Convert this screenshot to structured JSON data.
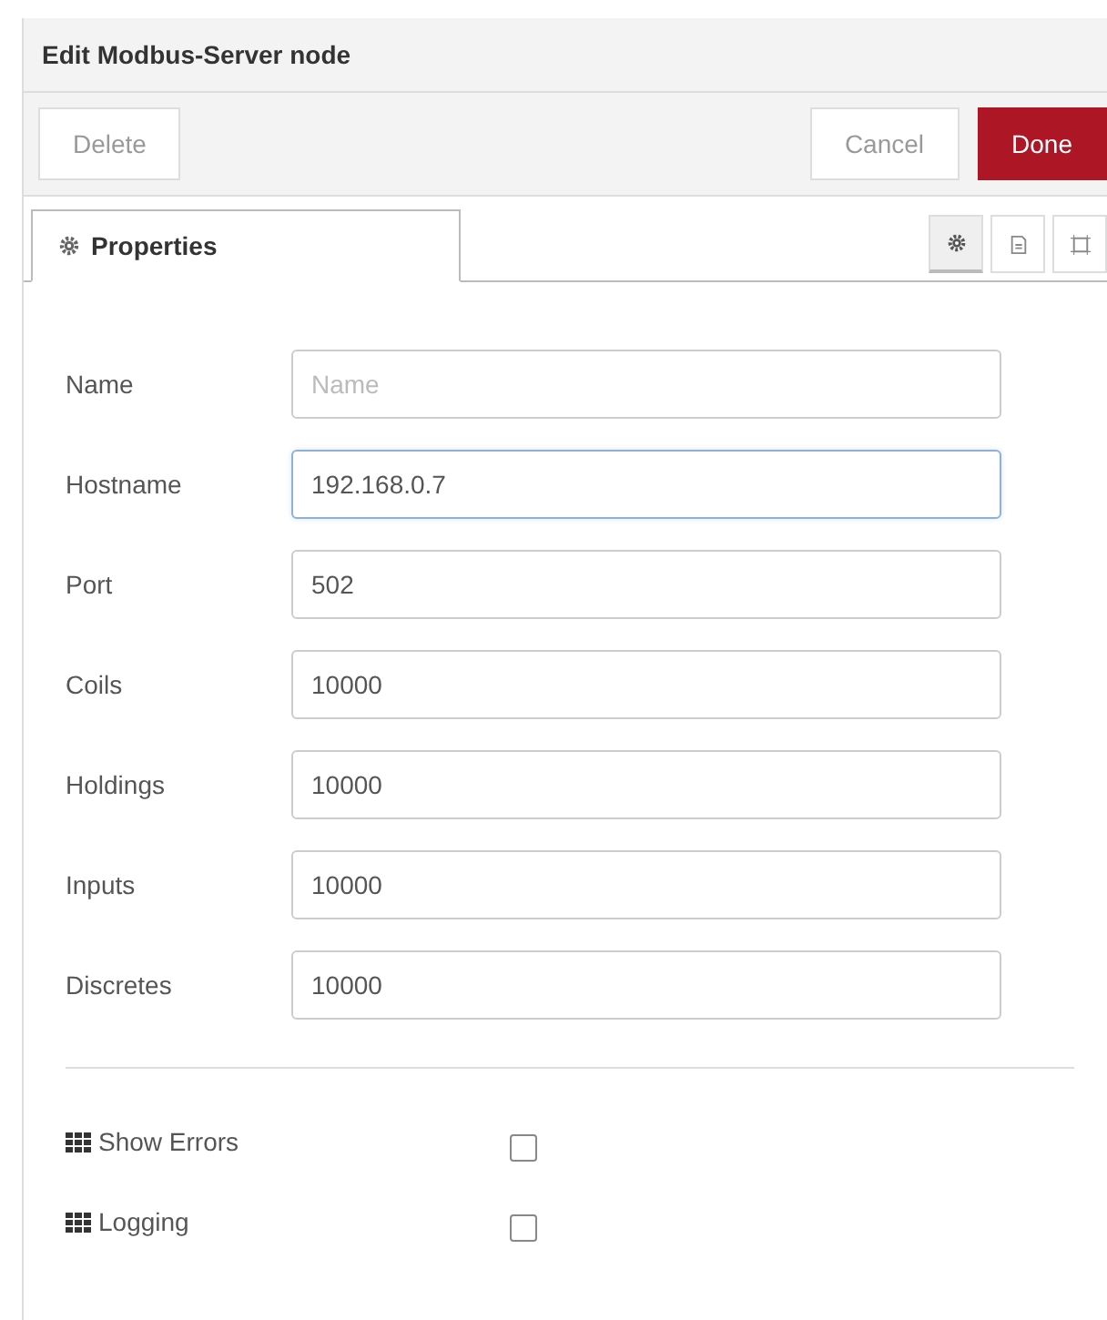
{
  "window": {
    "title": "Edit Modbus-Server node"
  },
  "buttons": {
    "delete": "Delete",
    "cancel": "Cancel",
    "done": "Done"
  },
  "tabs": [
    {
      "label": "Properties",
      "selected": true
    }
  ],
  "tab_icons": [
    {
      "kind": "gear",
      "selected": true
    },
    {
      "kind": "document",
      "selected": false
    },
    {
      "kind": "frame",
      "selected": false
    }
  ],
  "fields": [
    {
      "label": "Name",
      "placeholder": "Name",
      "focused": false
    },
    {
      "label": "Hostname",
      "value": "192.168.0.7",
      "focused": true
    },
    {
      "label": "Port",
      "value": "502",
      "focused": false
    },
    {
      "label": "Coils",
      "value": "10000",
      "focused": false
    },
    {
      "label": "Holdings",
      "value": "10000",
      "focused": false
    },
    {
      "label": "Inputs",
      "value": "10000",
      "focused": false
    },
    {
      "label": "Discretes",
      "value": "10000",
      "focused": false
    }
  ],
  "options": [
    {
      "label": "Show Errors",
      "checked": false
    },
    {
      "label": "Logging",
      "checked": false
    }
  ]
}
